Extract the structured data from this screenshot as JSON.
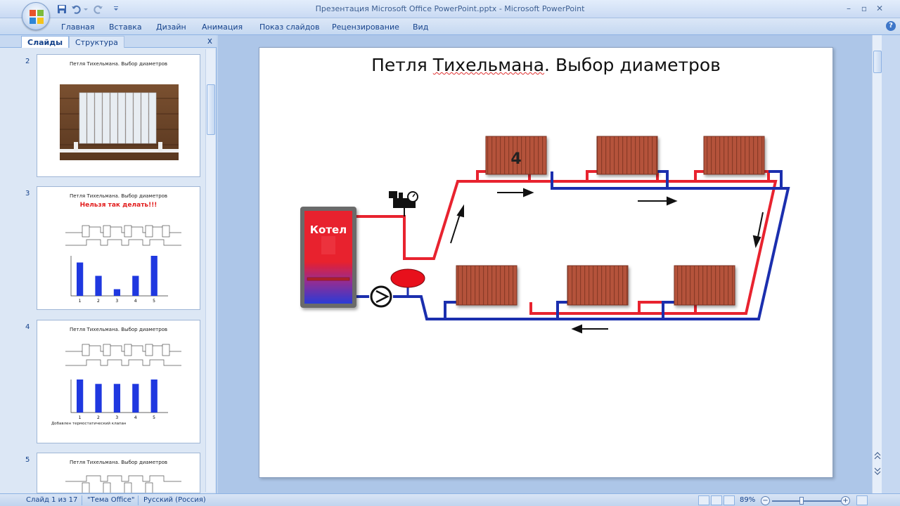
{
  "window": {
    "title": "Презентация Microsoft Office PowerPoint.pptx - Microsoft PowerPoint"
  },
  "ribbon": {
    "tabs": [
      "Главная",
      "Вставка",
      "Дизайн",
      "Анимация",
      "Показ слайдов",
      "Рецензирование",
      "Вид"
    ]
  },
  "panel": {
    "tabs": [
      "Слайды",
      "Структура"
    ],
    "close": "x",
    "slides": [
      {
        "number": "2",
        "title": "Петля Тихельмана. Выбор диаметров"
      },
      {
        "number": "3",
        "title": "Петля Тихельмана. Выбор диаметров",
        "warning": "Нельзя так делать!!!",
        "bars": [
          5,
          3,
          1,
          3,
          6
        ],
        "labels": [
          "1",
          "2",
          "3",
          "4",
          "5"
        ]
      },
      {
        "number": "4",
        "title": "Петля Тихельмана. Выбор диаметров",
        "bars": [
          3,
          2.6,
          2.6,
          2.6,
          3
        ],
        "labels": [
          "1",
          "2",
          "3",
          "4",
          "5"
        ],
        "caption": "Добавлен термостатический клапан"
      },
      {
        "number": "5",
        "title": "Петля Тихельмана. Выбор диаметров"
      }
    ]
  },
  "slide": {
    "title_plain": "Петля ",
    "title_spell": "Тихельмана",
    "title_rest": ". Выбор диаметров",
    "boiler_label": "Котел",
    "radiator_label": "4"
  },
  "status": {
    "slide_info": "Слайд 1 из 17",
    "theme": "\"Тема Office\"",
    "language": "Русский (Россия)",
    "zoom": "89%"
  },
  "colors": {
    "supply": "#e8232f",
    "return": "#1b2fae",
    "radiator": "#b5523b",
    "boiler": "#e01f2c",
    "accent": "#15428b"
  }
}
